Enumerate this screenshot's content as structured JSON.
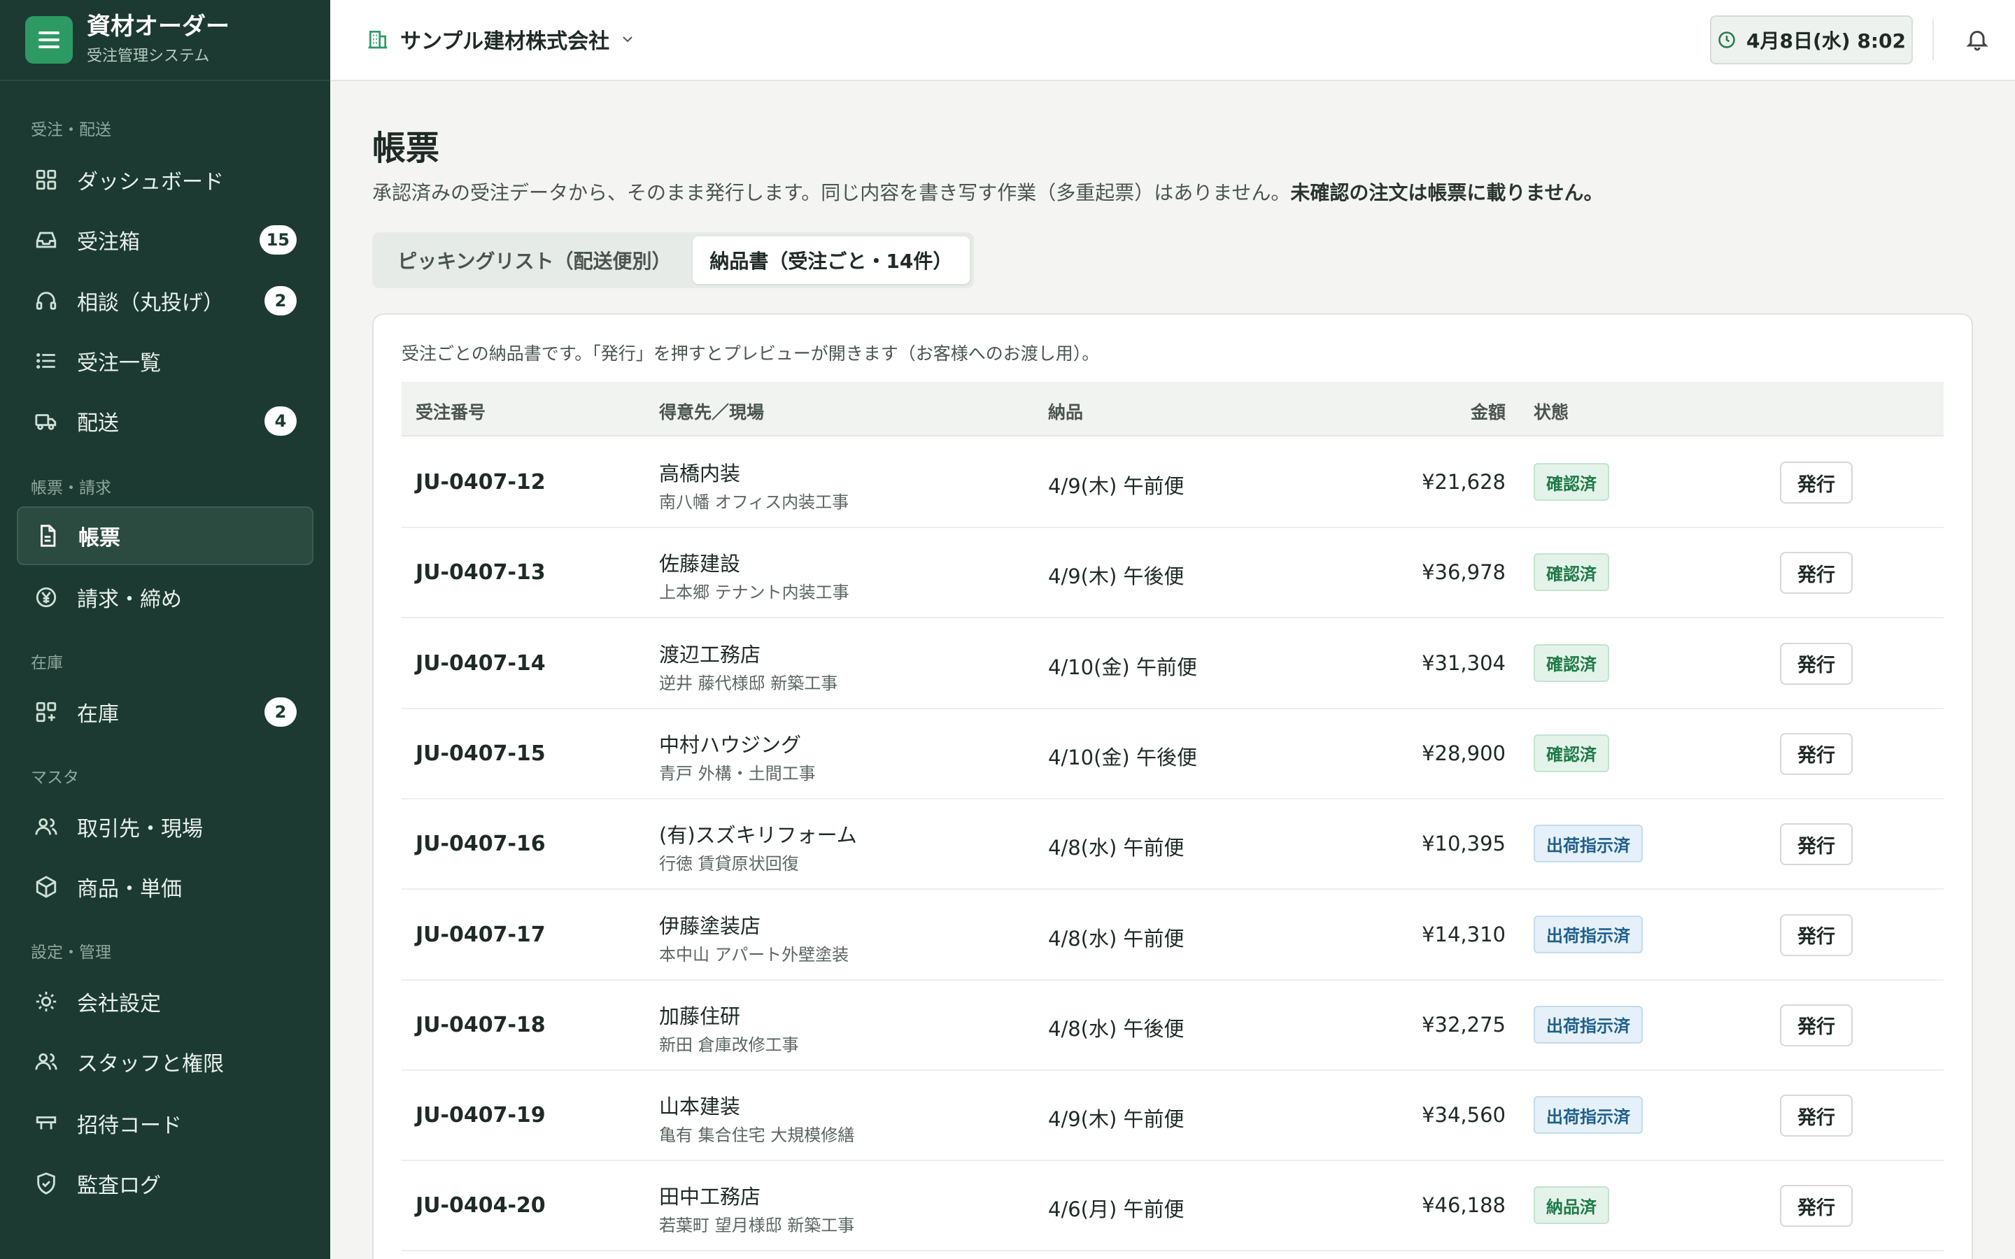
{
  "brand": {
    "title": "資材オーダー",
    "subtitle": "受注管理システム"
  },
  "sidebar": {
    "sections": [
      "受注・配送",
      "帳票・請求",
      "在庫",
      "マスタ",
      "設定・管理"
    ],
    "items": [
      {
        "label": "ダッシュボード",
        "icon": "grid-icon",
        "badge": ""
      },
      {
        "label": "受注箱",
        "icon": "inbox-icon",
        "badge": "15"
      },
      {
        "label": "相談（丸投げ）",
        "icon": "headset-icon",
        "badge": "2"
      },
      {
        "label": "受注一覧",
        "icon": "list-icon",
        "badge": ""
      },
      {
        "label": "配送",
        "icon": "truck-icon",
        "badge": "4"
      },
      {
        "label": "帳票",
        "icon": "document-icon",
        "badge": ""
      },
      {
        "label": "請求・締め",
        "icon": "yen-icon",
        "badge": ""
      },
      {
        "label": "在庫",
        "icon": "stock-icon",
        "badge": "2"
      },
      {
        "label": "取引先・現場",
        "icon": "users-icon",
        "badge": ""
      },
      {
        "label": "商品・単価",
        "icon": "box-icon",
        "badge": ""
      },
      {
        "label": "会社設定",
        "icon": "sun-gear-icon",
        "badge": ""
      },
      {
        "label": "スタッフと権限",
        "icon": "staff-icon",
        "badge": ""
      },
      {
        "label": "招待コード",
        "icon": "ticket-icon",
        "badge": ""
      },
      {
        "label": "監査ログ",
        "icon": "shield-icon",
        "badge": ""
      }
    ]
  },
  "header": {
    "company": "サンプル建材株式会社",
    "datetime": "4月8日(水) 8:02"
  },
  "main": {
    "title": "帳票",
    "desc": "承認済みの受注データから、そのまま発行します。同じ内容を書き写す作業（多重起票）はありません。",
    "desc_bold": "未確認の注文は帳票に載りません。",
    "tabs": [
      "ピッキングリスト（配送便別）",
      "納品書（受注ごと・14件）"
    ],
    "note": "受注ごとの納品書です。「発行」を押すとプレビューが開きます（お客様へのお渡し用）。",
    "columns": [
      "受注番号",
      "得意先／現場",
      "納品",
      "金額",
      "状態"
    ],
    "issue_label": "発行",
    "rows": [
      {
        "no": "JU-0407-12",
        "customer": "高橋内装",
        "site": "南八幡 オフィス内装工事",
        "delivery": "4/9(木) 午前便",
        "amount": "¥21,628",
        "status": "確認済",
        "status_color": "green"
      },
      {
        "no": "JU-0407-13",
        "customer": "佐藤建設",
        "site": "上本郷 テナント内装工事",
        "delivery": "4/9(木) 午後便",
        "amount": "¥36,978",
        "status": "確認済",
        "status_color": "green"
      },
      {
        "no": "JU-0407-14",
        "customer": "渡辺工務店",
        "site": "逆井 藤代様邸 新築工事",
        "delivery": "4/10(金) 午前便",
        "amount": "¥31,304",
        "status": "確認済",
        "status_color": "green"
      },
      {
        "no": "JU-0407-15",
        "customer": "中村ハウジング",
        "site": "青戸 外構・土間工事",
        "delivery": "4/10(金) 午後便",
        "amount": "¥28,900",
        "status": "確認済",
        "status_color": "green"
      },
      {
        "no": "JU-0407-16",
        "customer": "(有)スズキリフォーム",
        "site": "行徳 賃貸原状回復",
        "delivery": "4/8(水) 午前便",
        "amount": "¥10,395",
        "status": "出荷指示済",
        "status_color": "blue"
      },
      {
        "no": "JU-0407-17",
        "customer": "伊藤塗装店",
        "site": "本中山 アパート外壁塗装",
        "delivery": "4/8(水) 午前便",
        "amount": "¥14,310",
        "status": "出荷指示済",
        "status_color": "blue"
      },
      {
        "no": "JU-0407-18",
        "customer": "加藤住研",
        "site": "新田 倉庫改修工事",
        "delivery": "4/8(水) 午後便",
        "amount": "¥32,275",
        "status": "出荷指示済",
        "status_color": "blue"
      },
      {
        "no": "JU-0407-19",
        "customer": "山本建装",
        "site": "亀有 集合住宅 大規模修繕",
        "delivery": "4/9(木) 午前便",
        "amount": "¥34,560",
        "status": "出荷指示済",
        "status_color": "blue"
      },
      {
        "no": "JU-0404-20",
        "customer": "田中工務店",
        "site": "若葉町 望月様邸 新築工事",
        "delivery": "4/6(月) 午前便",
        "amount": "¥46,188",
        "status": "納品済",
        "status_color": "green"
      }
    ]
  },
  "colors": {
    "sidebar": "#1c3a31",
    "accent": "#2d9a63",
    "confirmed": "#1f7a48",
    "shipped": "#1f5f8b"
  }
}
